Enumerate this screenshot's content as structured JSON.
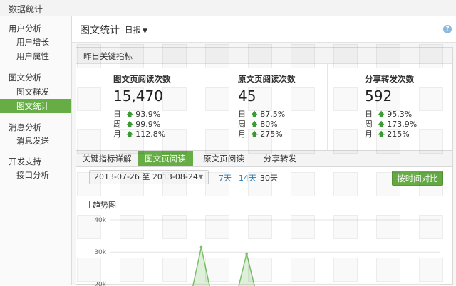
{
  "app": {
    "title": "数据统计"
  },
  "sidebar": {
    "groups": [
      {
        "label": "用户分析",
        "items": [
          {
            "label": "用户增长"
          },
          {
            "label": "用户属性"
          }
        ]
      },
      {
        "label": "图文分析",
        "items": [
          {
            "label": "图文群发"
          },
          {
            "label": "图文统计",
            "active": true
          }
        ]
      },
      {
        "label": "消息分析",
        "items": [
          {
            "label": "消息发送"
          }
        ]
      },
      {
        "label": "开发支持",
        "items": [
          {
            "label": "接口分析"
          }
        ]
      }
    ]
  },
  "header": {
    "title": "图文统计",
    "period": "日报",
    "help_icon": "question-circle-icon"
  },
  "key_metrics": {
    "title": "昨日关键指标",
    "metrics": [
      {
        "label": "图文页阅读次数",
        "value": "15,470",
        "comparisons": [
          {
            "period": "日",
            "pct": "93.9%"
          },
          {
            "period": "周",
            "pct": "99.9%"
          },
          {
            "period": "月",
            "pct": "112.8%"
          }
        ]
      },
      {
        "label": "原文页阅读次数",
        "value": "45",
        "comparisons": [
          {
            "period": "日",
            "pct": "87.5%"
          },
          {
            "period": "周",
            "pct": "80%"
          },
          {
            "period": "月",
            "pct": "275%"
          }
        ]
      },
      {
        "label": "分享转发次数",
        "value": "592",
        "comparisons": [
          {
            "period": "日",
            "pct": "95.3%"
          },
          {
            "period": "周",
            "pct": "173.9%"
          },
          {
            "period": "月",
            "pct": "215%"
          }
        ]
      }
    ],
    "arrow_icon": "up-arrow-icon",
    "arrow_color": "#3d9b35"
  },
  "detail": {
    "tabs": [
      {
        "label": "关键指标详解"
      },
      {
        "label": "图文页阅读",
        "active": true
      },
      {
        "label": "原文页阅读"
      },
      {
        "label": "分享转发"
      }
    ],
    "date_range": "2013-07-26 至 2013-08-24",
    "ranges": [
      {
        "label": "7天"
      },
      {
        "label": "14天"
      },
      {
        "label": "30天",
        "current": true
      }
    ],
    "compare_button": "按时间对比",
    "trend_title": "趋势图"
  },
  "colors": {
    "accent": "#66ad45",
    "link": "#2a7ab8",
    "series": "#7cbf6a"
  },
  "chart_data": {
    "type": "area",
    "title": "趋势图",
    "y_ticks": [
      "40k",
      "30k",
      "20k"
    ],
    "ylim": [
      15000,
      42000
    ],
    "grid": true,
    "series": [
      {
        "values": [
          15000,
          15000,
          15000,
          15000,
          15000,
          15000,
          15000,
          15000,
          31500,
          15000,
          15000,
          15000,
          29500,
          15000,
          15000,
          15000,
          15000,
          15000,
          15000,
          15000,
          15000,
          15000,
          15000,
          15000,
          15000,
          15000,
          15000,
          15000,
          15000,
          15000
        ]
      }
    ]
  }
}
